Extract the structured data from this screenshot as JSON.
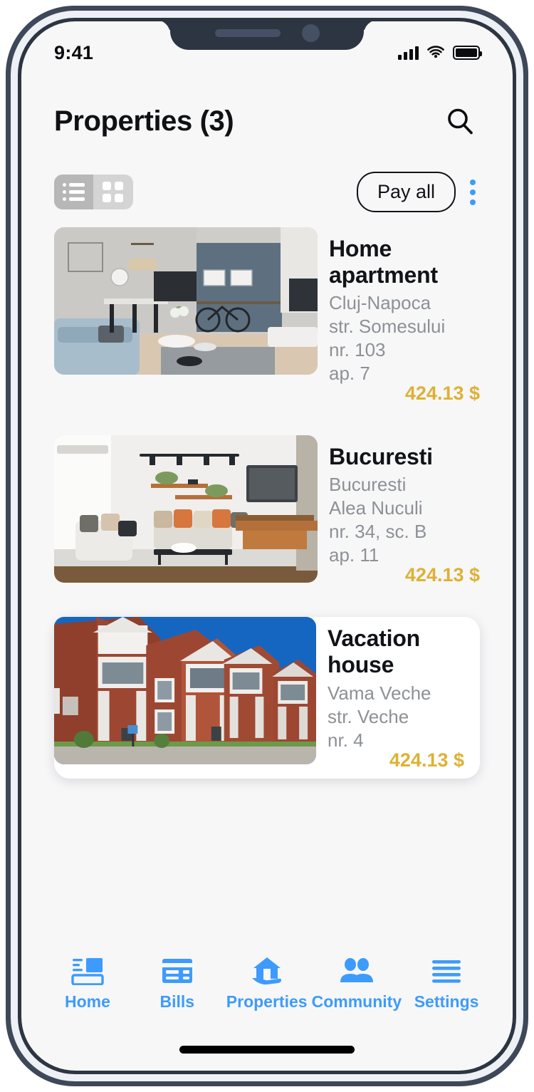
{
  "status_bar": {
    "time": "9:41",
    "icons": [
      "signal-icon",
      "wifi-icon",
      "battery-icon"
    ]
  },
  "header": {
    "title": "Properties (3)",
    "search_icon": "search-icon"
  },
  "toolbar": {
    "view_modes": [
      {
        "id": "list",
        "icon": "list-view-icon",
        "active": true
      },
      {
        "id": "grid",
        "icon": "grid-view-icon",
        "active": false
      }
    ],
    "pay_all_label": "Pay all",
    "overflow_icon": "kebab-menu-icon"
  },
  "properties": [
    {
      "name": "Home apartment",
      "city": "Cluj-Napoca",
      "street": "str. Somesului",
      "number": "nr. 103",
      "unit": "ap. 7",
      "price": "424.13 $",
      "image": "modern-living-room-kitchen",
      "selected": false
    },
    {
      "name": "Bucuresti",
      "city": "Bucuresti",
      "street": "Alea Nuculi",
      "number": "nr. 34, sc. B",
      "unit": "ap. 11",
      "price": "424.13 $",
      "image": "white-living-room-tv",
      "selected": false
    },
    {
      "name": "Vacation house",
      "city": "Vama Veche",
      "street": "str. Veche",
      "number": "nr. 4",
      "unit": "",
      "price": "424.13 $",
      "image": "brick-apartment-building",
      "selected": true
    }
  ],
  "tabbar": {
    "items": [
      {
        "label": "Home",
        "icon": "dashboard-icon"
      },
      {
        "label": "Bills",
        "icon": "card-icon"
      },
      {
        "label": "Properties",
        "icon": "house-in-hand-icon"
      },
      {
        "label": "Community",
        "icon": "people-icon"
      },
      {
        "label": "Settings",
        "icon": "menu-lines-icon"
      }
    ]
  },
  "colors": {
    "accent": "#3d9bfc",
    "price": "#deb135",
    "screen_bg": "#f7f7f8",
    "frame": "#3f4858"
  }
}
